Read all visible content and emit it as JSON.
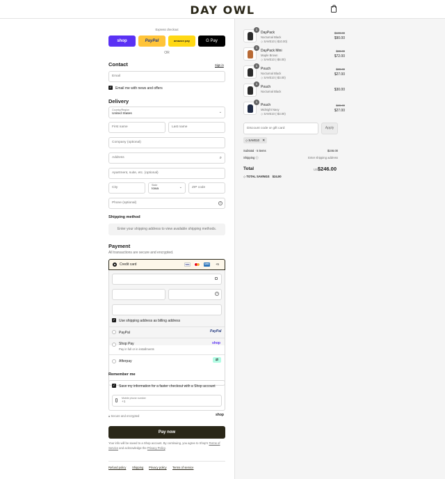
{
  "header": {
    "logo": "DAY OWL"
  },
  "express": {
    "title": "Express checkout",
    "shop": "shop",
    "paypal": "PayPal",
    "amazon": "amazon pay",
    "gpay": "G Pay",
    "or": "OR"
  },
  "contact": {
    "title": "Contact",
    "signin": "Sign in",
    "email_placeholder": "Email",
    "news_label": "Email me with news and offers"
  },
  "delivery": {
    "title": "Delivery",
    "country_label": "Country/Region",
    "country_value": "United States",
    "first_name": "First name",
    "last_name": "Last name",
    "company": "Company (optional)",
    "address": "Address",
    "apartment": "Apartment, suite, etc. (optional)",
    "city": "City",
    "state_label": "State",
    "state_value": "Iowa",
    "zip": "ZIP code",
    "phone": "Phone (optional)"
  },
  "shipping_method": {
    "title": "Shipping method",
    "message": "Enter your shipping address to view available shipping methods."
  },
  "payment": {
    "title": "Payment",
    "subtitle": "All transactions are secure and encrypted.",
    "credit_card": "Credit card",
    "more_cards": "+5",
    "billing_label": "Use shipping address as billing address",
    "paypal": "PayPal",
    "paypal_logo": "PayPal",
    "shop_pay": "Shop Pay",
    "shop_pay_sub": "Pay in full or in installments",
    "shop_logo": "shop",
    "afterpay": "Afterpay",
    "cards": [
      "VISA",
      "MC",
      "AMEX"
    ]
  },
  "remember": {
    "title": "Remember me",
    "save_label": "Save my information for a faster checkout with a Shop account",
    "mobile_label": "Mobile phone number",
    "mobile_value": "+1",
    "secure": "Secure and encrypted",
    "shop_logo": "shop"
  },
  "pay_button": "Pay now",
  "legal": {
    "line1": "Your info will be saved to a Shop account. By continuing, you agree to Shop's",
    "terms": "Terms of Service",
    "and": " and acknowledge the ",
    "privacy": "Privacy Policy",
    "end": "."
  },
  "footer_links": [
    "Refund policy",
    "Shipping",
    "Privacy policy",
    "Terms of service"
  ],
  "items": [
    {
      "qty": "1",
      "name": "DayPack",
      "variant": "Nocturnal Black",
      "discount": "SAVE10 (-$10.00)",
      "orig": "$100.00",
      "price": "$90.00",
      "color": "#2b2b2b"
    },
    {
      "qty": "1",
      "name": "DayPack Mini",
      "variant": "Maple Brown",
      "discount": "SAVE10 (-$8.00)",
      "orig": "$80.00",
      "price": "$72.00",
      "color": "#b86a35"
    },
    {
      "qty": "1",
      "name": "Pouch",
      "variant": "Nocturnal Black",
      "discount": "SAVE10 (-$3.00)",
      "orig": "$30.00",
      "price": "$27.00",
      "color": "#2b2b2b"
    },
    {
      "qty": "1",
      "name": "Pouch",
      "variant": "Nocturnal Black",
      "discount": "",
      "orig": "",
      "price": "$30.00",
      "color": "#2b2b2b"
    },
    {
      "qty": "1",
      "name": "Pouch",
      "variant": "Midnight Navy",
      "discount": "SAVE10 (-$3.00)",
      "orig": "$30.00",
      "price": "$27.00",
      "color": "#1f2a44"
    }
  ],
  "summary": {
    "code_placeholder": "Discount code or gift card",
    "apply": "Apply",
    "tag": "SAVE10",
    "subtotal_label": "Subtotal · 5 items",
    "subtotal": "$246.00",
    "shipping_label": "Shipping",
    "shipping_value": "Enter shipping address",
    "total_label": "Total",
    "currency": "USD",
    "total": "$246.00",
    "savings_label": "TOTAL SAVINGS",
    "savings": "$24.00"
  },
  "colors": {
    "shop": "#5a31f4",
    "paypal": "#ffc439",
    "amazon": "#ffd814",
    "primary": "#2a2718",
    "selected_bg": "#fdf7ea"
  }
}
